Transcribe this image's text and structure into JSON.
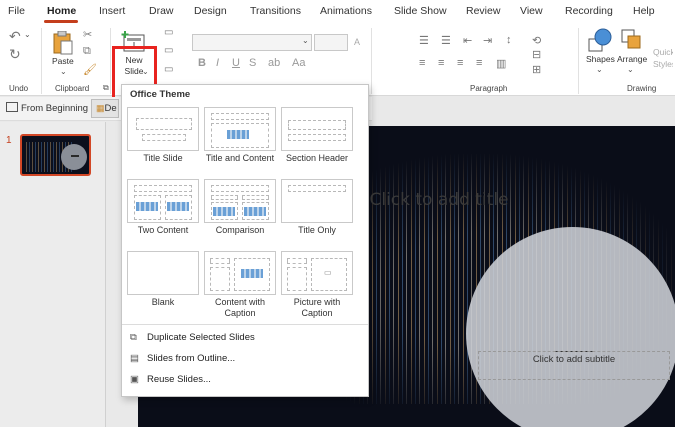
{
  "tabs": [
    "File",
    "Home",
    "Insert",
    "Draw",
    "Design",
    "Transitions",
    "Animations",
    "Slide Show",
    "Review",
    "View",
    "Recording",
    "Help"
  ],
  "ribbon": {
    "paste_label": "Paste",
    "new_slide_label": "New Slide",
    "shapes_label": "Shapes",
    "arrange_label": "Arrange",
    "quick_styles_label": "Quick Styles",
    "groups": [
      "Undo",
      "Clipboard",
      "Paragraph",
      "Drawing"
    ]
  },
  "quick_bar": {
    "from_beginning": "From Beginning",
    "truncated_button": "De"
  },
  "slide_panel": {
    "slide_number": "1"
  },
  "dropdown": {
    "header": "Office Theme",
    "layouts": [
      "Title Slide",
      "Title and Content",
      "Section Header",
      "Two Content",
      "Comparison",
      "Title Only",
      "Blank",
      "Content with Caption",
      "Picture with Caption"
    ],
    "menu": [
      "Duplicate Selected Slides",
      "Slides from Outline...",
      "Reuse Slides..."
    ]
  },
  "slide": {
    "title_placeholder": "Click to add title",
    "subtitle_placeholder": "Click to add subtitle"
  },
  "colors": {
    "accent": "#c43e1c",
    "highlight": "#e8231f",
    "slide_bg": "#0a0d18"
  }
}
